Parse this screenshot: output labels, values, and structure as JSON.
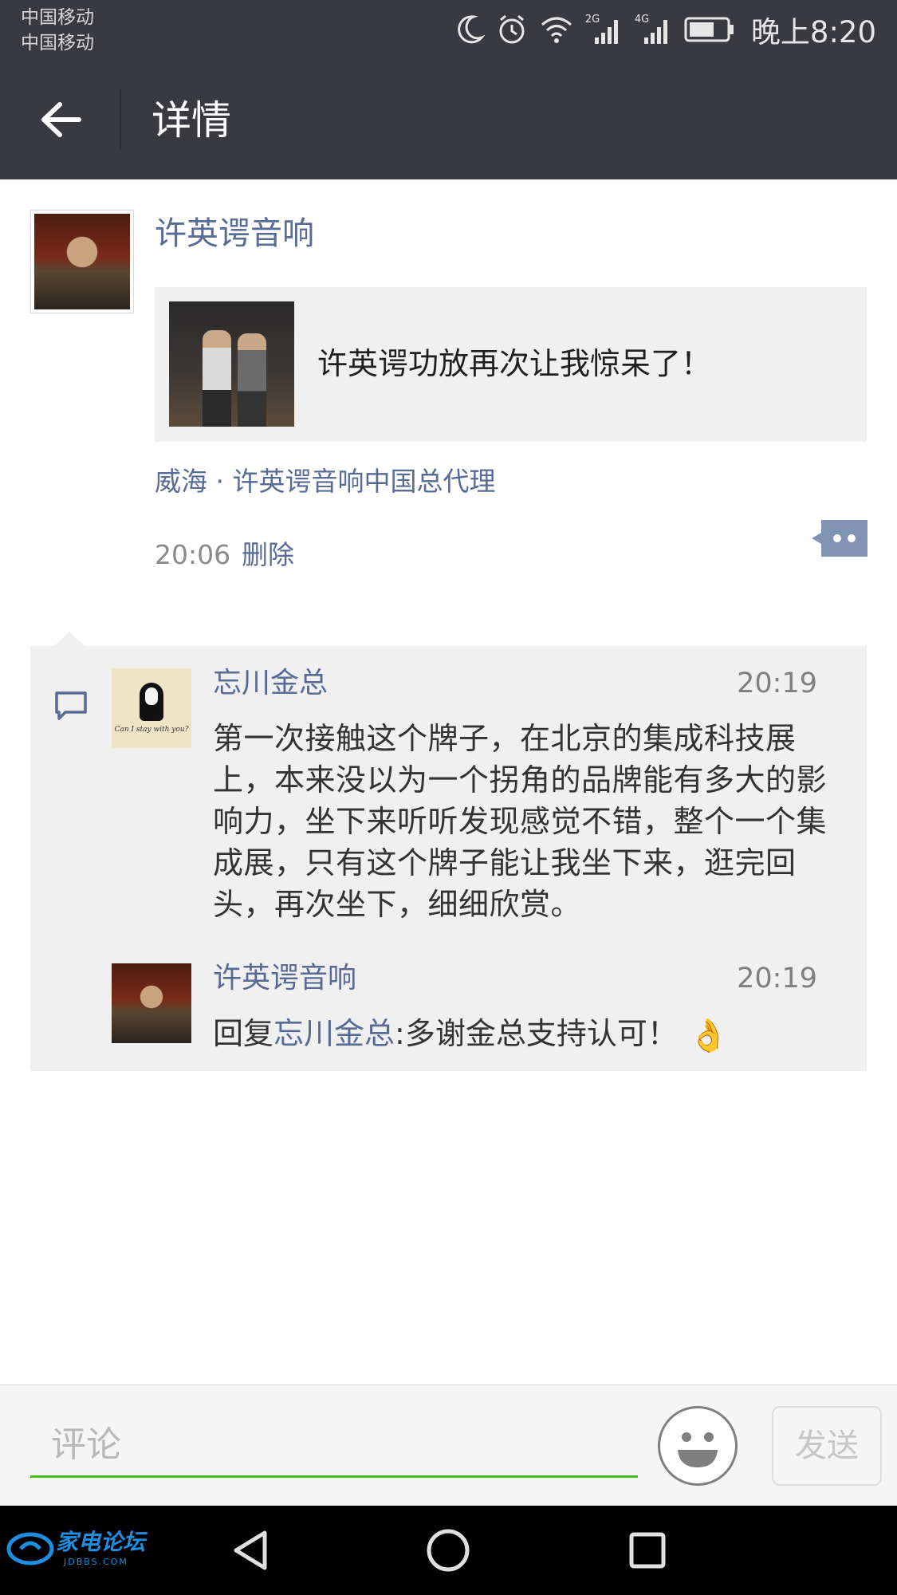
{
  "status_bar": {
    "carrier_1": "中国移动",
    "carrier_2": "中国移动",
    "time": "晚上8:20",
    "signal_1_label": "2G",
    "signal_2_label": "4G"
  },
  "header": {
    "title": "详情"
  },
  "post": {
    "author": "许英谔音响",
    "link_title": "许英谔功放再次让我惊呆了！",
    "location": "威海 · 许英谔音响中国总代理",
    "time": "20:06",
    "delete_label": "删除"
  },
  "comments": [
    {
      "author": "忘川金总",
      "time": "20:19",
      "text": "第一次接触这个牌子，在北京的集成科技展上，本来没以为一个拐角的品牌能有多大的影响力，坐下来听听发现感觉不错，整个一个集成展，只有这个牌子能让我坐下来，逛完回头，再次坐下，细细欣赏。",
      "avatar_caption": "Can I stay with you?"
    },
    {
      "author": "许英谔音响",
      "time": "20:19",
      "reply_prefix": "回复",
      "reply_to": "忘川金总",
      "reply_text": ":多谢金总支持认可！",
      "emoji": "👌"
    }
  ],
  "input_bar": {
    "placeholder": "评论",
    "send_label": "发送"
  },
  "watermark": {
    "text": "家电论坛",
    "sub": "JDBBS.COM"
  },
  "colors": {
    "bar_bg": "#393a3f",
    "link_blue": "#576b95",
    "comment_bg": "#f0f0f0",
    "input_accent": "#45c01a"
  },
  "icons": {
    "back": "arrow-left-icon",
    "comment_toggle": "more-dots-icon",
    "comments_section": "speech-bubble-icon",
    "emoji": "smiley-face-icon",
    "nav_back": "triangle-back-icon",
    "nav_home": "circle-home-icon",
    "nav_recents": "square-recents-icon"
  }
}
